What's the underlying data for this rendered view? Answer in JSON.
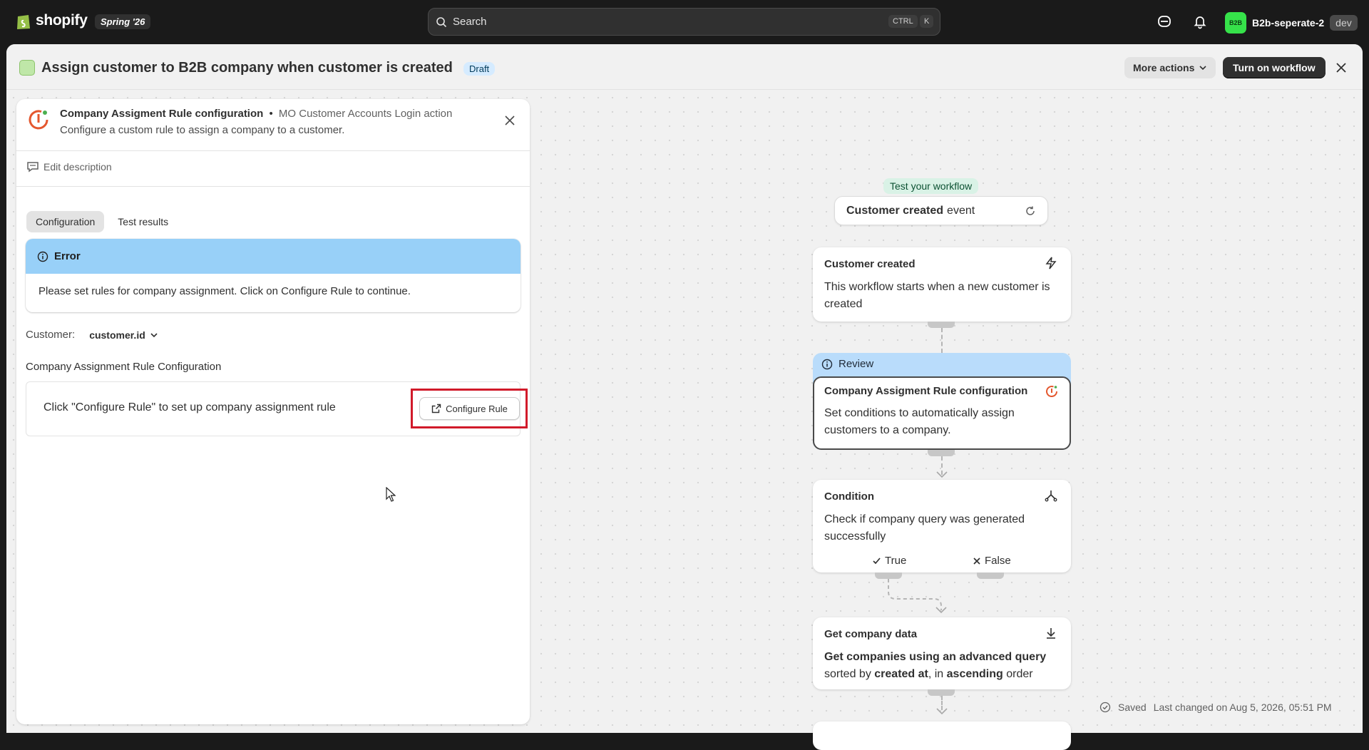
{
  "topbar": {
    "brand": "shopify",
    "edition": "Spring '26",
    "search_placeholder": "Search",
    "kbd_ctrl": "CTRL",
    "kbd_k": "K",
    "store_avatar": "B2B",
    "store_name": "B2b-seperate-2",
    "store_tag": "dev"
  },
  "window": {
    "title": "Assign customer to B2B company when customer is created",
    "status": "Draft",
    "more_actions": "More actions",
    "turn_on": "Turn on workflow"
  },
  "panel": {
    "title": "Company Assigment Rule configuration",
    "bullet": "•",
    "source": "MO Customer Accounts Login action",
    "description": "Configure a custom rule to assign a company to a customer.",
    "edit_description": "Edit description",
    "tabs": [
      {
        "label": "Configuration",
        "active": true
      },
      {
        "label": "Test results",
        "active": false
      }
    ],
    "error": {
      "title": "Error",
      "message": "Please set rules for company assignment. Click on Configure Rule to continue."
    },
    "customer_label": "Customer:",
    "customer_value": "customer.id",
    "section_title": "Company Assignment Rule Configuration",
    "rule_hint": "Click \"Configure Rule\" to set up company assignment rule",
    "configure_button": "Configure Rule"
  },
  "flow": {
    "test_label": "Test your workflow",
    "event_bold": "Customer created",
    "event_rest": "event",
    "nodes": {
      "trigger": {
        "title": "Customer created",
        "description": "This workflow starts when a new customer is created"
      },
      "review_label": "Review",
      "action": {
        "title": "Company Assigment Rule configuration",
        "description": "Set conditions to automatically assign customers to a company."
      },
      "condition": {
        "title": "Condition",
        "description": "Check if company query was generated successfully",
        "true_label": "True",
        "false_label": "False"
      },
      "get_data": {
        "title": "Get company data",
        "desc_bold": "Get companies using an advanced query",
        "desc_sorted": "sorted by",
        "desc_field": "created at",
        "desc_in": ", in",
        "desc_order": "ascending",
        "desc_end": "order"
      }
    }
  },
  "footer": {
    "saved": "Saved",
    "last_changed": "Last changed on Aug 5, 2026, 05:51 PM"
  },
  "colors": {
    "topbar": "#1a1a1a",
    "error_header": "#98d0f8",
    "review_header": "#b9dcfb",
    "highlight": "#d11a2a",
    "store_avatar": "#36e24a"
  }
}
